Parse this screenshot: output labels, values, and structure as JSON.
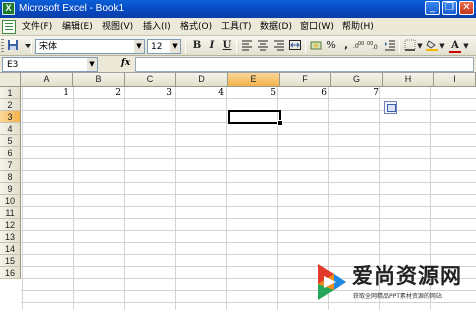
{
  "window": {
    "title": "Microsoft Excel - Book1",
    "app_icon_label": "X",
    "minimize_glyph": "_",
    "restore_glyph": "❐",
    "close_glyph": "✕"
  },
  "menu": {
    "items": [
      {
        "label": "文件(F)"
      },
      {
        "label": "编辑(E)"
      },
      {
        "label": "视图(V)"
      },
      {
        "label": "插入(I)"
      },
      {
        "label": "格式(O)"
      },
      {
        "label": "工具(T)"
      },
      {
        "label": "数据(D)"
      },
      {
        "label": "窗口(W)"
      },
      {
        "label": "帮助(H)"
      }
    ]
  },
  "toolbar": {
    "font_name": "宋体",
    "font_size": "12",
    "bold": "B",
    "italic": "I",
    "underline": "U",
    "percent": "%",
    "comma": ",",
    "font_color_label": "A",
    "accent_fill": "#f5b800",
    "accent_font": "#d00000"
  },
  "formula_bar": {
    "name_box": "E3",
    "fx_label": "fx",
    "formula": ""
  },
  "grid": {
    "columns": [
      "A",
      "B",
      "C",
      "D",
      "E",
      "F",
      "G",
      "H",
      "I"
    ],
    "rows": [
      "1",
      "2",
      "3",
      "4",
      "5",
      "6",
      "7",
      "8",
      "9",
      "10",
      "11",
      "12",
      "13",
      "14",
      "15",
      "16"
    ],
    "selected_column": "E",
    "selected_row": "3",
    "active_cell": "E3",
    "row1_values": [
      "1",
      "2",
      "3",
      "4",
      "5",
      "6",
      "7"
    ]
  },
  "watermark": {
    "title": "爱尚资源网",
    "subtitle": "获取全网精品PPT素材资源的网站"
  }
}
